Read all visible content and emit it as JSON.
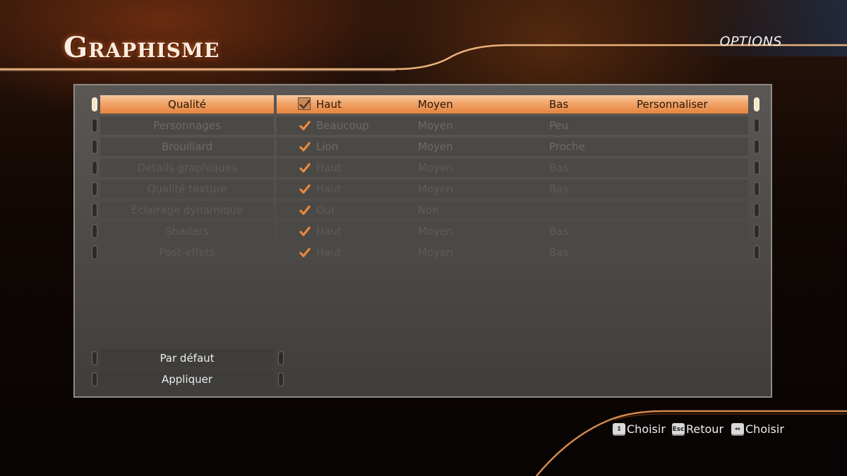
{
  "header": {
    "title": "Graphisme",
    "section": "OPTIONS"
  },
  "settings": {
    "rows": [
      {
        "name": "Qualité",
        "options": [
          "Haut",
          "Moyen",
          "Bas",
          "Personnaliser"
        ]
      },
      {
        "name": "Personnages",
        "options": [
          "Beaucoup",
          "Moyen",
          "Peu",
          ""
        ]
      },
      {
        "name": "Brouillard",
        "options": [
          "Lion",
          "Moyen",
          "Proche",
          ""
        ]
      },
      {
        "name": "Détails graphiques",
        "options": [
          "Haut",
          "Moyen",
          "Bas",
          ""
        ]
      },
      {
        "name": "Qualité texture",
        "options": [
          "Haut",
          "Moyen",
          "Bas",
          ""
        ]
      },
      {
        "name": "Éclairage dynamique",
        "options": [
          "Oui",
          "Non",
          "",
          ""
        ]
      },
      {
        "name": "Shaders",
        "options": [
          "Haut",
          "Moyen",
          "Bas",
          ""
        ]
      },
      {
        "name": "Post-effets",
        "options": [
          "Haut",
          "Moyen",
          "Bas",
          ""
        ]
      }
    ]
  },
  "buttons": {
    "default_label": "Par défaut",
    "apply_label": "Appliquer"
  },
  "hints": [
    {
      "key": "↕",
      "label": "Choisir"
    },
    {
      "key": "Esc",
      "label": "Retour"
    },
    {
      "key": "↔",
      "label": "Choisir"
    }
  ],
  "colors": {
    "accent": "#f0a468",
    "check": "#f28a3a",
    "panel": "#4b4946"
  }
}
